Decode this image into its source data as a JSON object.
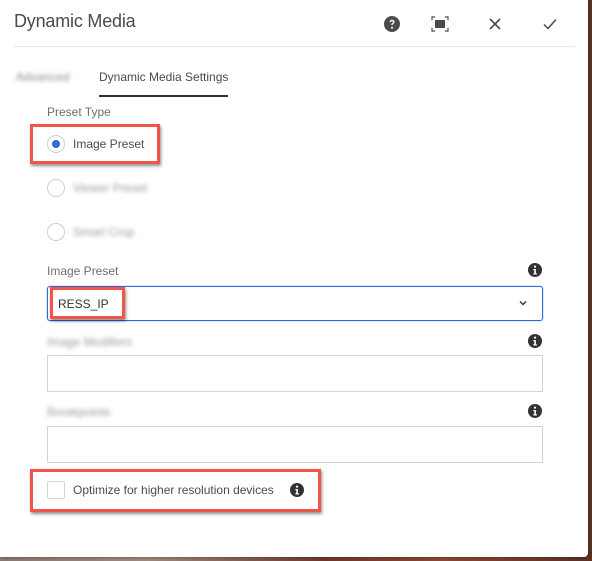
{
  "dialog": {
    "title": "Dynamic Media",
    "actions": {
      "help": "help-icon",
      "fullscreen": "fullscreen-icon",
      "close": "close-icon",
      "done": "checkmark-icon"
    }
  },
  "tabs": [
    {
      "label": "Advanced",
      "active": false
    },
    {
      "label": "Dynamic Media Settings",
      "active": true
    }
  ],
  "preset_type": {
    "label": "Preset Type",
    "options": [
      {
        "label": "Image Preset",
        "selected": true
      },
      {
        "label": "Viewer Preset",
        "selected": false
      },
      {
        "label": "Smart Crop",
        "selected": false
      }
    ]
  },
  "image_preset": {
    "label": "Image Preset",
    "value": "RESS_IP"
  },
  "image_modifiers": {
    "label": "Image Modifiers",
    "value": ""
  },
  "breakpoints": {
    "label": "Breakpoints",
    "value": ""
  },
  "optimize": {
    "label": "Optimize for higher resolution devices",
    "checked": false
  },
  "colors": {
    "accent": "#2d6cd8",
    "highlight": "#f0544a",
    "text": "#4b4b4b"
  }
}
